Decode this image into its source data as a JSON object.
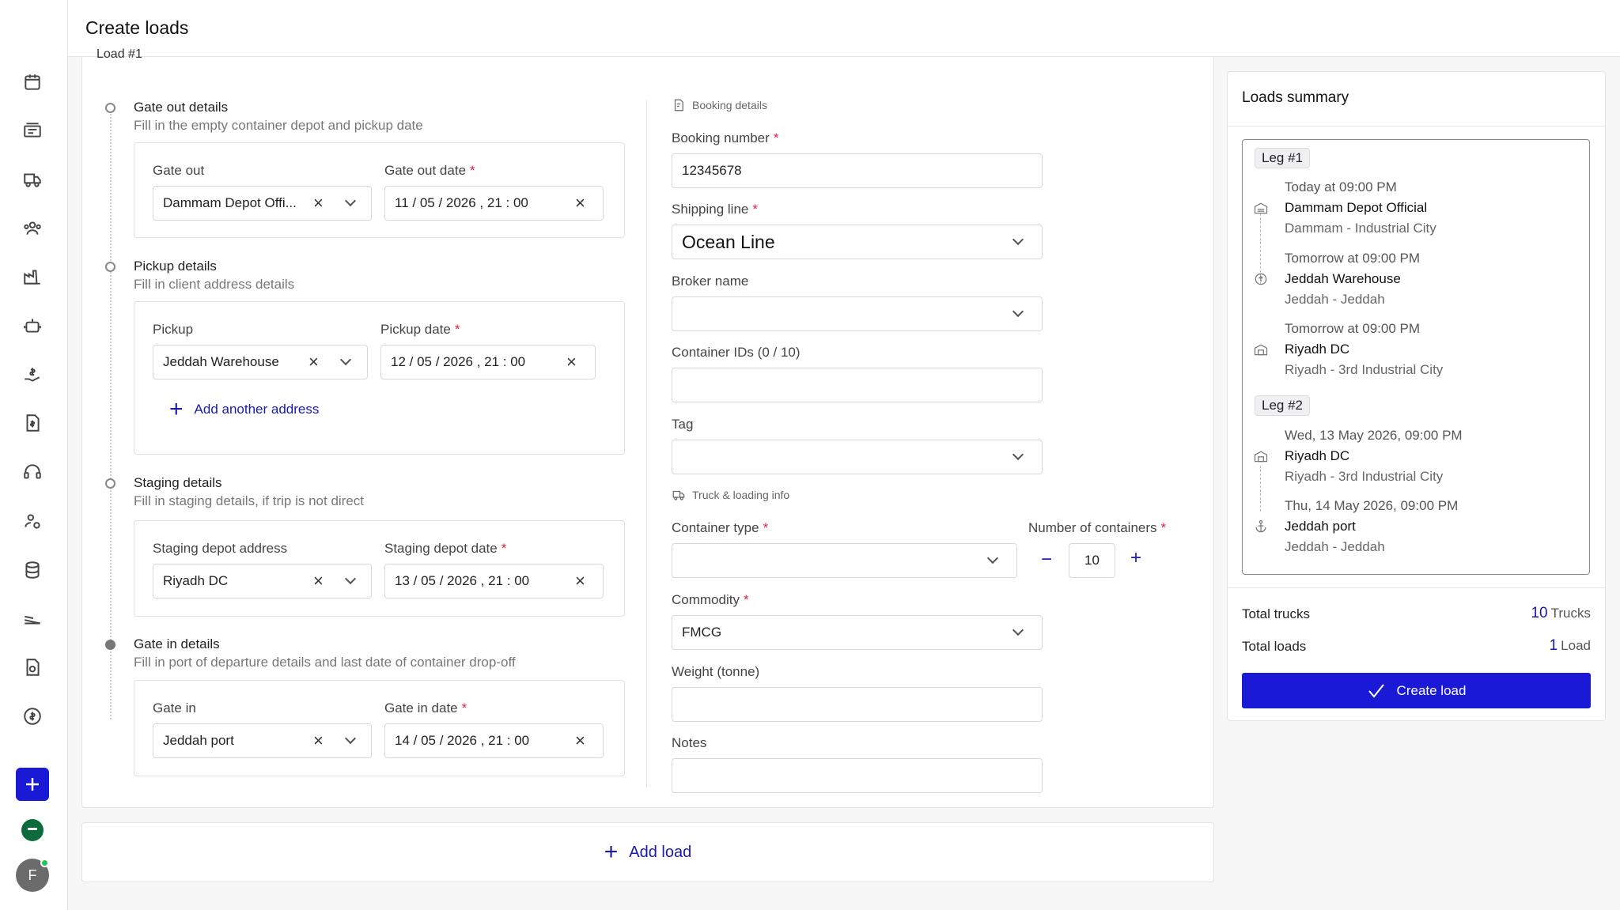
{
  "page": {
    "title": "Create loads",
    "load_label": "Load #1"
  },
  "sidebar": {
    "icons": [
      "calendar-icon",
      "tickets-icon",
      "truck-icon",
      "users-icon",
      "factory-icon",
      "robot-icon",
      "hand-dollar-icon",
      "invoice-icon",
      "headset-icon",
      "user-settings-icon",
      "database-icon",
      "ramp-icon",
      "document-dollar-icon",
      "dollar-circle-icon"
    ],
    "add_icon": "plus-icon",
    "avatar_initial": "F"
  },
  "gate_out": {
    "title": "Gate out details",
    "subtitle": "Fill in the empty container depot and pickup date",
    "location_label": "Gate out",
    "location_value": "Dammam Depot Offi...",
    "date_label": "Gate out date",
    "date_value": "11 / 05 / 2026 ,  21 : 00"
  },
  "pickup": {
    "title": "Pickup details",
    "subtitle": "Fill in client address details",
    "location_label": "Pickup",
    "location_value": "Jeddah Warehouse",
    "date_label": "Pickup date",
    "date_value": "12 / 05 / 2026 ,  21 : 00",
    "add_address": "Add another address"
  },
  "staging": {
    "title": "Staging details",
    "subtitle": "Fill in staging details, if trip is not direct",
    "location_label": "Staging depot address",
    "location_value": "Riyadh DC",
    "date_label": "Staging depot date",
    "date_value": "13 / 05 / 2026 ,  21 : 00"
  },
  "gate_in": {
    "title": "Gate in details",
    "subtitle": "Fill in port of departure details and last date of container drop-off",
    "location_label": "Gate in",
    "location_value": "Jeddah port",
    "date_label": "Gate in date",
    "date_value": "14 / 05 / 2026 ,  21 : 00"
  },
  "booking": {
    "heading": "Booking details",
    "booking_number_label": "Booking number",
    "booking_number_value": "12345678",
    "shipping_line_label": "Shipping line",
    "shipping_line_value": "Ocean Line",
    "broker_label": "Broker name",
    "container_ids_label": "Container IDs (0 / 10)",
    "tag_label": "Tag"
  },
  "truck": {
    "heading": "Truck & loading info",
    "container_type_label": "Container type",
    "num_containers_label": "Number of containers",
    "num_containers_value": "10",
    "commodity_label": "Commodity",
    "commodity_value": "FMCG",
    "weight_label": "Weight (tonne)",
    "notes_label": "Notes"
  },
  "add_load": "Add load",
  "summary": {
    "title": "Loads summary",
    "legs": [
      {
        "badge": "Leg #1",
        "stops": [
          {
            "time": "Today at 09:00 PM",
            "name": "Dammam Depot Official",
            "city": "Dammam - Industrial City",
            "icon": "depot-icon"
          },
          {
            "time": "Tomorrow at 09:00 PM",
            "name": "Jeddah Warehouse",
            "city": "Jeddah - Jeddah",
            "icon": "pickup-icon"
          },
          {
            "time": "Tomorrow at 09:00 PM",
            "name": "Riyadh DC",
            "city": "Riyadh - 3rd Industrial City",
            "icon": "warehouse-icon"
          }
        ]
      },
      {
        "badge": "Leg #2",
        "stops": [
          {
            "time": "Wed, 13 May 2026, 09:00 PM",
            "name": "Riyadh DC",
            "city": "Riyadh - 3rd Industrial City",
            "icon": "warehouse-icon"
          },
          {
            "time": "Thu, 14 May 2026, 09:00 PM",
            "name": "Jeddah port",
            "city": "Jeddah - Jeddah",
            "icon": "port-icon"
          }
        ]
      }
    ],
    "total_trucks_label": "Total trucks",
    "total_trucks_value": "10",
    "total_trucks_unit": "Trucks",
    "total_loads_label": "Total loads",
    "total_loads_value": "1",
    "total_loads_unit": "Load",
    "create_label": "Create load"
  },
  "colors": {
    "accent": "#1a1ad6",
    "link": "#1a1aa8",
    "required": "#e11d48"
  }
}
